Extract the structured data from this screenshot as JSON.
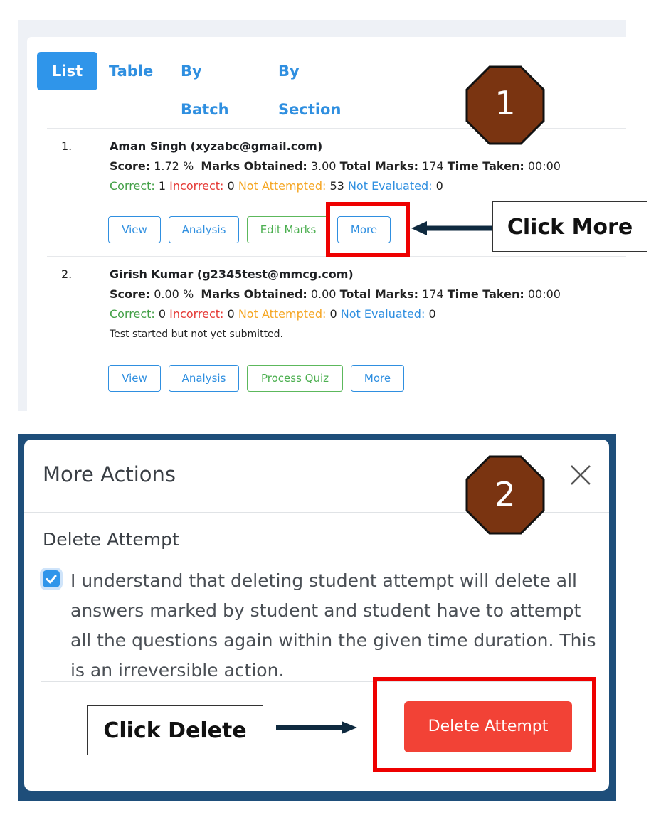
{
  "tabs": [
    {
      "label": "List",
      "active": true
    },
    {
      "label": "Table",
      "active": false
    },
    {
      "label": "By Batch",
      "active": false
    },
    {
      "label": "By Section",
      "active": false
    }
  ],
  "labels": {
    "score": "Score:",
    "marks_obtained": "Marks Obtained:",
    "total_marks": "Total Marks:",
    "time_taken": "Time Taken:",
    "correct": "Correct:",
    "incorrect": "Incorrect:",
    "not_attempted": "Not Attempted:",
    "not_evaluated": "Not Evaluated:"
  },
  "attempts": [
    {
      "num": "1.",
      "name": "Aman Singh (xyzabc@gmail.com)",
      "score": "1.72 %",
      "marks_obtained": "3.00",
      "total_marks": "174",
      "time_taken": "00:00",
      "correct": "1",
      "incorrect": "0",
      "not_attempted": "53",
      "not_evaluated": "0",
      "note": "",
      "buttons": [
        "View",
        "Analysis",
        "Edit Marks",
        "More"
      ]
    },
    {
      "num": "2.",
      "name": "Girish Kumar (g2345test@mmcg.com)",
      "score": "0.00 %",
      "marks_obtained": "0.00",
      "total_marks": "174",
      "time_taken": "00:00",
      "correct": "0",
      "incorrect": "0",
      "not_attempted": "0",
      "not_evaluated": "0",
      "note": "Test started but not yet submitted.",
      "buttons": [
        "View",
        "Analysis",
        "Process Quiz",
        "More"
      ]
    }
  ],
  "annotations": {
    "step1": "1",
    "step2": "2",
    "click_more": "Click More",
    "click_delete": "Click Delete"
  },
  "modal": {
    "title": "More Actions",
    "section_title": "Delete Attempt",
    "checkbox_checked": true,
    "consent_text": "I understand that deleting student attempt will delete all answers marked by student and student have to attempt all the questions again within the given time duration. This is an irreversible action.",
    "delete_label": "Delete Attempt"
  },
  "colors": {
    "accent": "#2f95ea",
    "correct": "#43a047",
    "incorrect": "#e53935",
    "not_attempted": "#f5a623",
    "not_evaluated": "#2f8fe0",
    "danger": "#f24236",
    "highlight": "#ee0000",
    "badge": "#7a3411"
  },
  "icons": {
    "close": "close-icon",
    "check": "check-icon",
    "badge": "octagon-badge-icon",
    "arrow": "left-arrow-icon"
  }
}
